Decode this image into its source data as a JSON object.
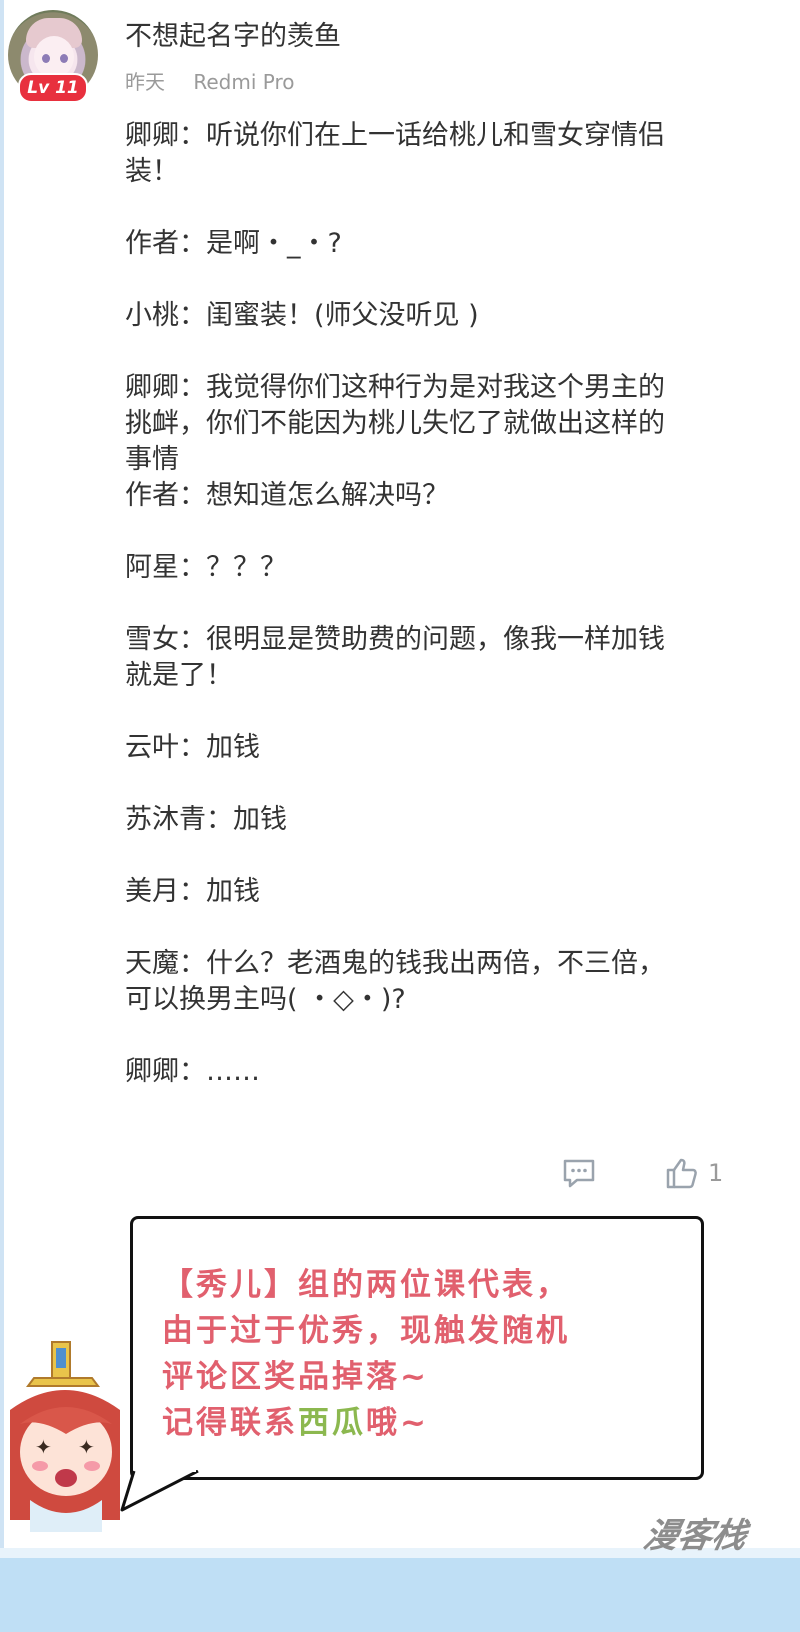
{
  "post": {
    "username": "不想起名字的羡鱼",
    "level": "Lv 11",
    "time": "昨天",
    "device": "Redmi Pro",
    "lines": [
      "卿卿：听说你们在上一话给桃儿和雪女穿情侣",
      "装！",
      "作者：是啊・_・?",
      "小桃：闺蜜装！(师父没听见 )",
      "卿卿：我觉得你们这种行为是对我这个男主的",
      "挑衅，你们不能因为桃儿失忆了就做出这样的",
      "事情",
      "作者：想知道怎么解决吗？",
      "阿星：？？？",
      "雪女：很明显是赞助费的问题，像我一样加钱",
      "就是了！",
      "云叶：加钱",
      "苏沐青：加钱",
      "美月：加钱",
      "天魔：什么？老酒鬼的钱我出两倍，不三倍，",
      "可以换男主吗( ・◇・)?",
      "卿卿：……"
    ],
    "like_count": "1"
  },
  "announcement": {
    "line1": "【秀儿】组的两位课代表，",
    "line2": "由于过于优秀，现触发随机",
    "line3": "评论区奖品掉落~",
    "line4_a": "记得联系",
    "line4_b": "西瓜",
    "line4_c": "哦~"
  },
  "watermark": "漫客栈",
  "colors": {
    "announcement_red": "#e1606e",
    "announcement_green": "#8cb84f",
    "level_badge": "#e8303e"
  },
  "icons": {
    "reply": "comment-bubble-icon",
    "like": "thumbs-up-icon"
  }
}
